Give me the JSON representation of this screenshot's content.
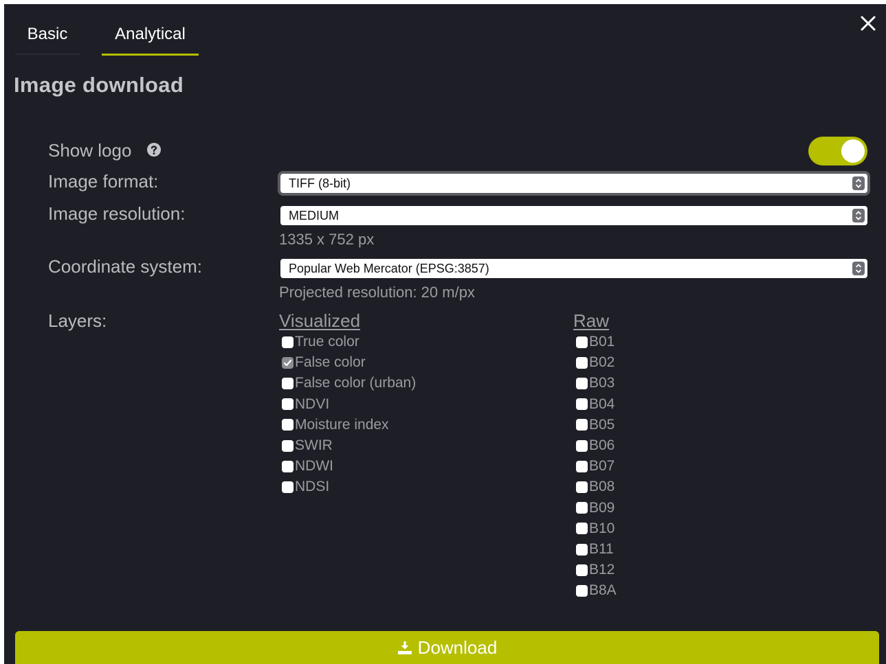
{
  "tabs": [
    {
      "label": "Basic",
      "active": false
    },
    {
      "label": "Analytical",
      "active": true
    }
  ],
  "title": "Image download",
  "show_logo": {
    "label": "Show logo",
    "help_icon": "question-circle-icon",
    "enabled": true
  },
  "image_format": {
    "label": "Image format:",
    "value": "TIFF (8-bit)"
  },
  "image_resolution": {
    "label": "Image resolution:",
    "value": "MEDIUM",
    "dimensions": "1335 x 752 px"
  },
  "coordinate_system": {
    "label": "Coordinate system:",
    "value": "Popular Web Mercator (EPSG:3857)",
    "projected": "Projected resolution: 20 m/px"
  },
  "layers": {
    "label": "Layers:",
    "visualized_heading": "Visualized",
    "raw_heading": "Raw",
    "visualized": [
      {
        "label": "True color",
        "checked": false
      },
      {
        "label": "False color",
        "checked": true
      },
      {
        "label": "False color (urban)",
        "checked": false
      },
      {
        "label": "NDVI",
        "checked": false
      },
      {
        "label": "Moisture index",
        "checked": false
      },
      {
        "label": "SWIR",
        "checked": false
      },
      {
        "label": "NDWI",
        "checked": false
      },
      {
        "label": "NDSI",
        "checked": false
      }
    ],
    "raw": [
      {
        "label": "B01",
        "checked": false
      },
      {
        "label": "B02",
        "checked": false
      },
      {
        "label": "B03",
        "checked": false
      },
      {
        "label": "B04",
        "checked": false
      },
      {
        "label": "B05",
        "checked": false
      },
      {
        "label": "B06",
        "checked": false
      },
      {
        "label": "B07",
        "checked": false
      },
      {
        "label": "B08",
        "checked": false
      },
      {
        "label": "B09",
        "checked": false
      },
      {
        "label": "B10",
        "checked": false
      },
      {
        "label": "B11",
        "checked": false
      },
      {
        "label": "B12",
        "checked": false
      },
      {
        "label": "B8A",
        "checked": false
      }
    ]
  },
  "download": {
    "label": "Download",
    "icon": "download-icon"
  },
  "colors": {
    "background": "#1e1f26",
    "accent": "#b6bf00",
    "text_muted": "#9a9ca2",
    "text_label": "#b9bbc0"
  }
}
